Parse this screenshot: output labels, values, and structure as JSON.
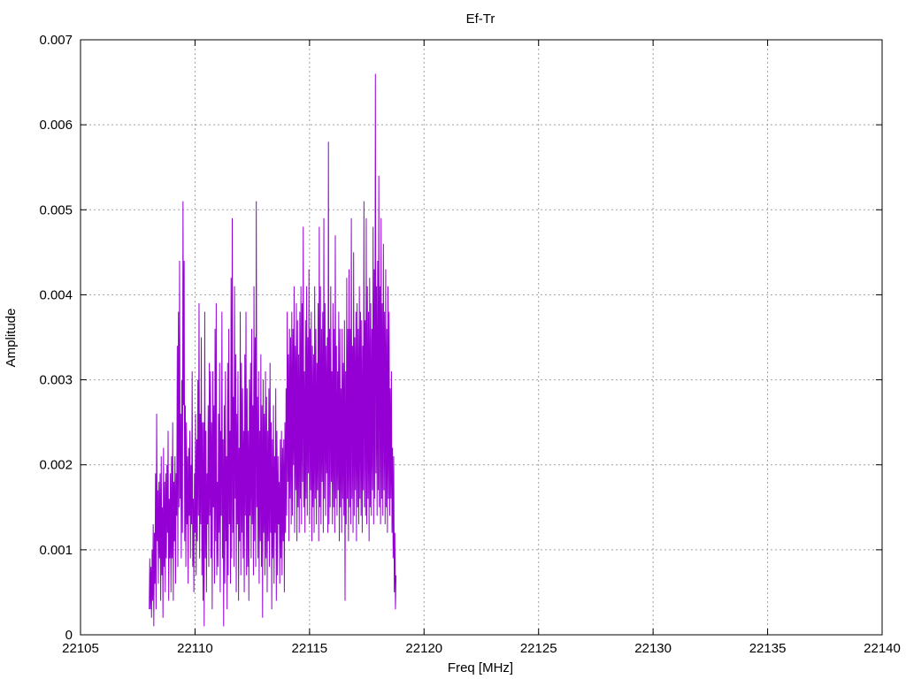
{
  "chart_data": {
    "type": "line",
    "title": "Ef-Tr",
    "xlabel": "Freq [MHz]",
    "ylabel": "Amplitude",
    "xlim": [
      22105,
      22140
    ],
    "ylim": [
      0,
      0.007
    ],
    "grid": true,
    "legend": "none",
    "x_ticks": [
      22105,
      22110,
      22115,
      22120,
      22125,
      22130,
      22135,
      22140
    ],
    "x_tick_labels": [
      "22105",
      "22110",
      "22115",
      "22120",
      "22125",
      "22130",
      "22135",
      "22140"
    ],
    "y_ticks": [
      0,
      0.001,
      0.002,
      0.003,
      0.004,
      0.005,
      0.006,
      0.007
    ],
    "y_tick_labels": [
      "0",
      "0.001",
      "0.002",
      "0.003",
      "0.004",
      "0.005",
      "0.006",
      "0.007"
    ],
    "series": [
      {
        "color": "#9400d3",
        "x_start": 22108.0,
        "x_step": 0.025,
        "values": [
          0.0003,
          0.0009,
          0.0003,
          0.0008,
          0.0002,
          0.001,
          0.0004,
          0.0013,
          0.0001,
          0.0012,
          0.0006,
          0.0019,
          0.0003,
          0.0026,
          0.0011,
          0.0017,
          0.0006,
          0.0018,
          0.0009,
          0.0019,
          0.0004,
          0.0021,
          0.0007,
          0.0015,
          0.0002,
          0.0022,
          0.0008,
          0.0018,
          0.0005,
          0.0019,
          0.0009,
          0.002,
          0.0012,
          0.0024,
          0.0004,
          0.0016,
          0.0009,
          0.0019,
          0.0005,
          0.0021,
          0.0009,
          0.0025,
          0.0004,
          0.0018,
          0.0011,
          0.0021,
          0.0006,
          0.0019,
          0.0014,
          0.0034,
          0.0008,
          0.0038,
          0.0015,
          0.0044,
          0.0016,
          0.0026,
          0.0009,
          0.003,
          0.0012,
          0.0051,
          0.0027,
          0.0044,
          0.0011,
          0.0027,
          0.0008,
          0.0025,
          0.0013,
          0.0021,
          0.0006,
          0.0022,
          0.0014,
          0.0024,
          0.0009,
          0.002,
          0.0013,
          0.0031,
          0.0008,
          0.0016,
          0.0005,
          0.0019,
          0.0012,
          0.0026,
          0.0007,
          0.0023,
          0.0011,
          0.003,
          0.0014,
          0.0039,
          0.0009,
          0.0026,
          0.0013,
          0.0035,
          0.0007,
          0.0025,
          0.0004,
          0.0025,
          0.0001,
          0.0038,
          0.0009,
          0.0024,
          0.0005,
          0.0019,
          0.0013,
          0.0027,
          0.0008,
          0.0032,
          0.0014,
          0.0031,
          0.0009,
          0.0025,
          0.0003,
          0.0031,
          0.0015,
          0.0027,
          0.0006,
          0.0036,
          0.0011,
          0.0039,
          0.0007,
          0.0018,
          0.0008,
          0.0026,
          0.0012,
          0.0032,
          0.0005,
          0.0024,
          0.0014,
          0.0038,
          0.0009,
          0.0023,
          0.0001,
          0.0027,
          0.0006,
          0.0031,
          0.0011,
          0.0021,
          0.0003,
          0.0032,
          0.0007,
          0.0036,
          0.0013,
          0.0024,
          0.0006,
          0.0042,
          0.0009,
          0.0049,
          0.0012,
          0.0028,
          0.0008,
          0.0041,
          0.0016,
          0.0033,
          0.0005,
          0.0026,
          0.0013,
          0.0031,
          0.0004,
          0.0022,
          0.0011,
          0.0038,
          0.0007,
          0.0032,
          0.0012,
          0.0029,
          0.0009,
          0.0024,
          0.0005,
          0.0033,
          0.0014,
          0.0038,
          0.0007,
          0.0029,
          0.0008,
          0.0024,
          0.0004,
          0.003,
          0.0014,
          0.0032,
          0.0009,
          0.0036,
          0.0013,
          0.0027,
          0.0007,
          0.0041,
          0.0011,
          0.0035,
          0.0008,
          0.0051,
          0.0015,
          0.0028,
          0.0009,
          0.0031,
          0.0006,
          0.0024,
          0.0011,
          0.0033,
          0.0008,
          0.0027,
          0.0002,
          0.003,
          0.0012,
          0.0026,
          0.0007,
          0.0031,
          0.0009,
          0.0028,
          0.0005,
          0.0024,
          0.0011,
          0.0029,
          0.0008,
          0.0032,
          0.0012,
          0.0025,
          0.0003,
          0.0023,
          0.0009,
          0.0027,
          0.0006,
          0.0021,
          0.0012,
          0.0029,
          0.0004,
          0.0024,
          0.0007,
          0.0021,
          0.0013,
          0.0018,
          0.0006,
          0.0023,
          0.0009,
          0.0024,
          0.0007,
          0.0022,
          0.0011,
          0.0023,
          0.0005,
          0.0025,
          0.0012,
          0.0029,
          0.0014,
          0.0038,
          0.0018,
          0.0033,
          0.0011,
          0.0036,
          0.0016,
          0.0035,
          0.0013,
          0.0038,
          0.0014,
          0.0036,
          0.002,
          0.0041,
          0.0012,
          0.0034,
          0.0017,
          0.0039,
          0.0011,
          0.0037,
          0.0015,
          0.0033,
          0.0012,
          0.0038,
          0.0016,
          0.0041,
          0.0013,
          0.0039,
          0.0018,
          0.0048,
          0.0015,
          0.0031,
          0.0012,
          0.0037,
          0.0016,
          0.0041,
          0.0014,
          0.0035,
          0.0019,
          0.0043,
          0.0013,
          0.0036,
          0.0017,
          0.0038,
          0.0011,
          0.0034,
          0.0015,
          0.0033,
          0.0012,
          0.0041,
          0.0016,
          0.0036,
          0.0013,
          0.0032,
          0.0017,
          0.0039,
          0.0011,
          0.0048,
          0.0015,
          0.0041,
          0.0013,
          0.0036,
          0.0018,
          0.0038,
          0.0012,
          0.0049,
          0.0016,
          0.0039,
          0.0014,
          0.0034,
          0.0019,
          0.0035,
          0.0012,
          0.0058,
          0.0013,
          0.0036,
          0.0015,
          0.0041,
          0.0018,
          0.0031,
          0.0013,
          0.0039,
          0.0015,
          0.0036,
          0.0012,
          0.0047,
          0.0016,
          0.0034,
          0.0014,
          0.0031,
          0.0017,
          0.0038,
          0.0011,
          0.0036,
          0.0015,
          0.0029,
          0.0012,
          0.0036,
          0.0016,
          0.0032,
          0.0014,
          0.0037,
          0.0004,
          0.0031,
          0.0013,
          0.0042,
          0.0016,
          0.0036,
          0.0011,
          0.0043,
          0.0015,
          0.0036,
          0.0013,
          0.0049,
          0.0016,
          0.0034,
          0.0012,
          0.0045,
          0.0014,
          0.0035,
          0.0017,
          0.0038,
          0.0011,
          0.0039,
          0.0015,
          0.0036,
          0.0013,
          0.0041,
          0.0016,
          0.0038,
          0.0014,
          0.0037,
          0.0012,
          0.0034,
          0.0017,
          0.0051,
          0.0015,
          0.0037,
          0.0014,
          0.0049,
          0.0013,
          0.0041,
          0.0016,
          0.0038,
          0.0011,
          0.0042,
          0.0015,
          0.0039,
          0.0014,
          0.0036,
          0.0017,
          0.0048,
          0.0013,
          0.0043,
          0.0016,
          0.0066,
          0.0019,
          0.0041,
          0.0014,
          0.0044,
          0.0017,
          0.0054,
          0.0015,
          0.0041,
          0.0013,
          0.0049,
          0.0016,
          0.0039,
          0.0014,
          0.0046,
          0.0017,
          0.0038,
          0.0013,
          0.0043,
          0.0015,
          0.0036,
          0.0012,
          0.0041,
          0.0016,
          0.0038,
          0.0014,
          0.0029,
          0.0016,
          0.0031,
          0.0012,
          0.0022,
          0.0009,
          0.0021,
          0.0005,
          0.0012,
          0.0003,
          0.0007
        ]
      }
    ]
  }
}
